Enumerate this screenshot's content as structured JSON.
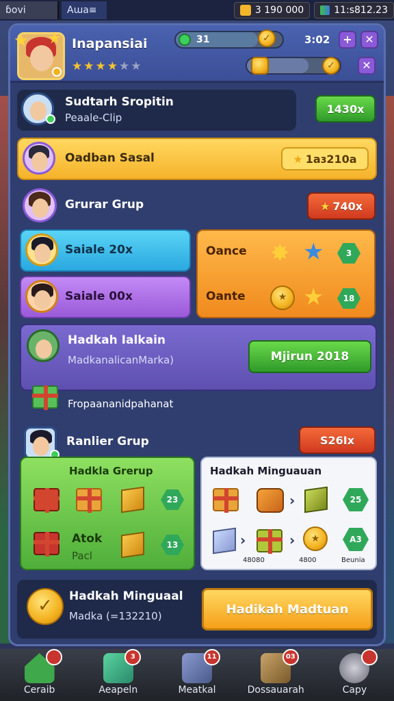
{
  "topbar": {
    "left_label": "ɓovi",
    "left2_label": "Aɯa≡",
    "currency1": "3  190 000",
    "currency2": "11:s812.23"
  },
  "header": {
    "title": "Inapansiai",
    "gem_value": "31",
    "timer": "3:02",
    "stars_filled": 4,
    "stars_total": 6
  },
  "rows": {
    "r1": {
      "name": "Sudtarh Sropitin",
      "sub": "Peaale-Clip",
      "price": "1430x"
    },
    "r2": {
      "name": "Oadban Sasal",
      "price": "1aɜ210a"
    },
    "r3": {
      "name": "Grurar Grup",
      "price": "740x"
    },
    "r4a": {
      "name": "Saiale 20x",
      "right": "Oance"
    },
    "r4b": {
      "name": "Saiale 00x",
      "right": "Oante"
    },
    "r4_hex1": "3",
    "r4_hex2": "18",
    "r5": {
      "name": "Hadkah Ialkain",
      "sub": "MadkanalicanMarka)",
      "button": "Mjirun 2018"
    },
    "r6_label": "Fropaananidpahanat",
    "r7": {
      "name": "Ranlier Grup",
      "price": "S26Ix"
    },
    "pack1": {
      "title": "Hadkla Grerup",
      "name": "Atok",
      "sub": "Pacl",
      "hex1": "23",
      "hex2": "13"
    },
    "pack2": {
      "title": "Hadkah Minguauan",
      "hex1": "25",
      "hex2": "A3",
      "cap1": "48080",
      "cap2": "4800",
      "cap3": "Beunia"
    },
    "bottom": {
      "name": "Hadkah Minguaal",
      "sub": "Madka (=132210)",
      "button": "Hadikah Madtuan"
    }
  },
  "nav": [
    {
      "label": "Ceraib",
      "badge": ""
    },
    {
      "label": "Aeapeln",
      "badge": "3"
    },
    {
      "label": "Meatkal",
      "badge": "11"
    },
    {
      "label": "Dossauarah",
      "badge": "03"
    },
    {
      "label": "Capy",
      "badge": ""
    }
  ],
  "colors": {
    "accent_green": "#43b83a",
    "accent_yellow": "#f7c240",
    "accent_red": "#e04a2a",
    "panel": "#2f3e6e"
  }
}
